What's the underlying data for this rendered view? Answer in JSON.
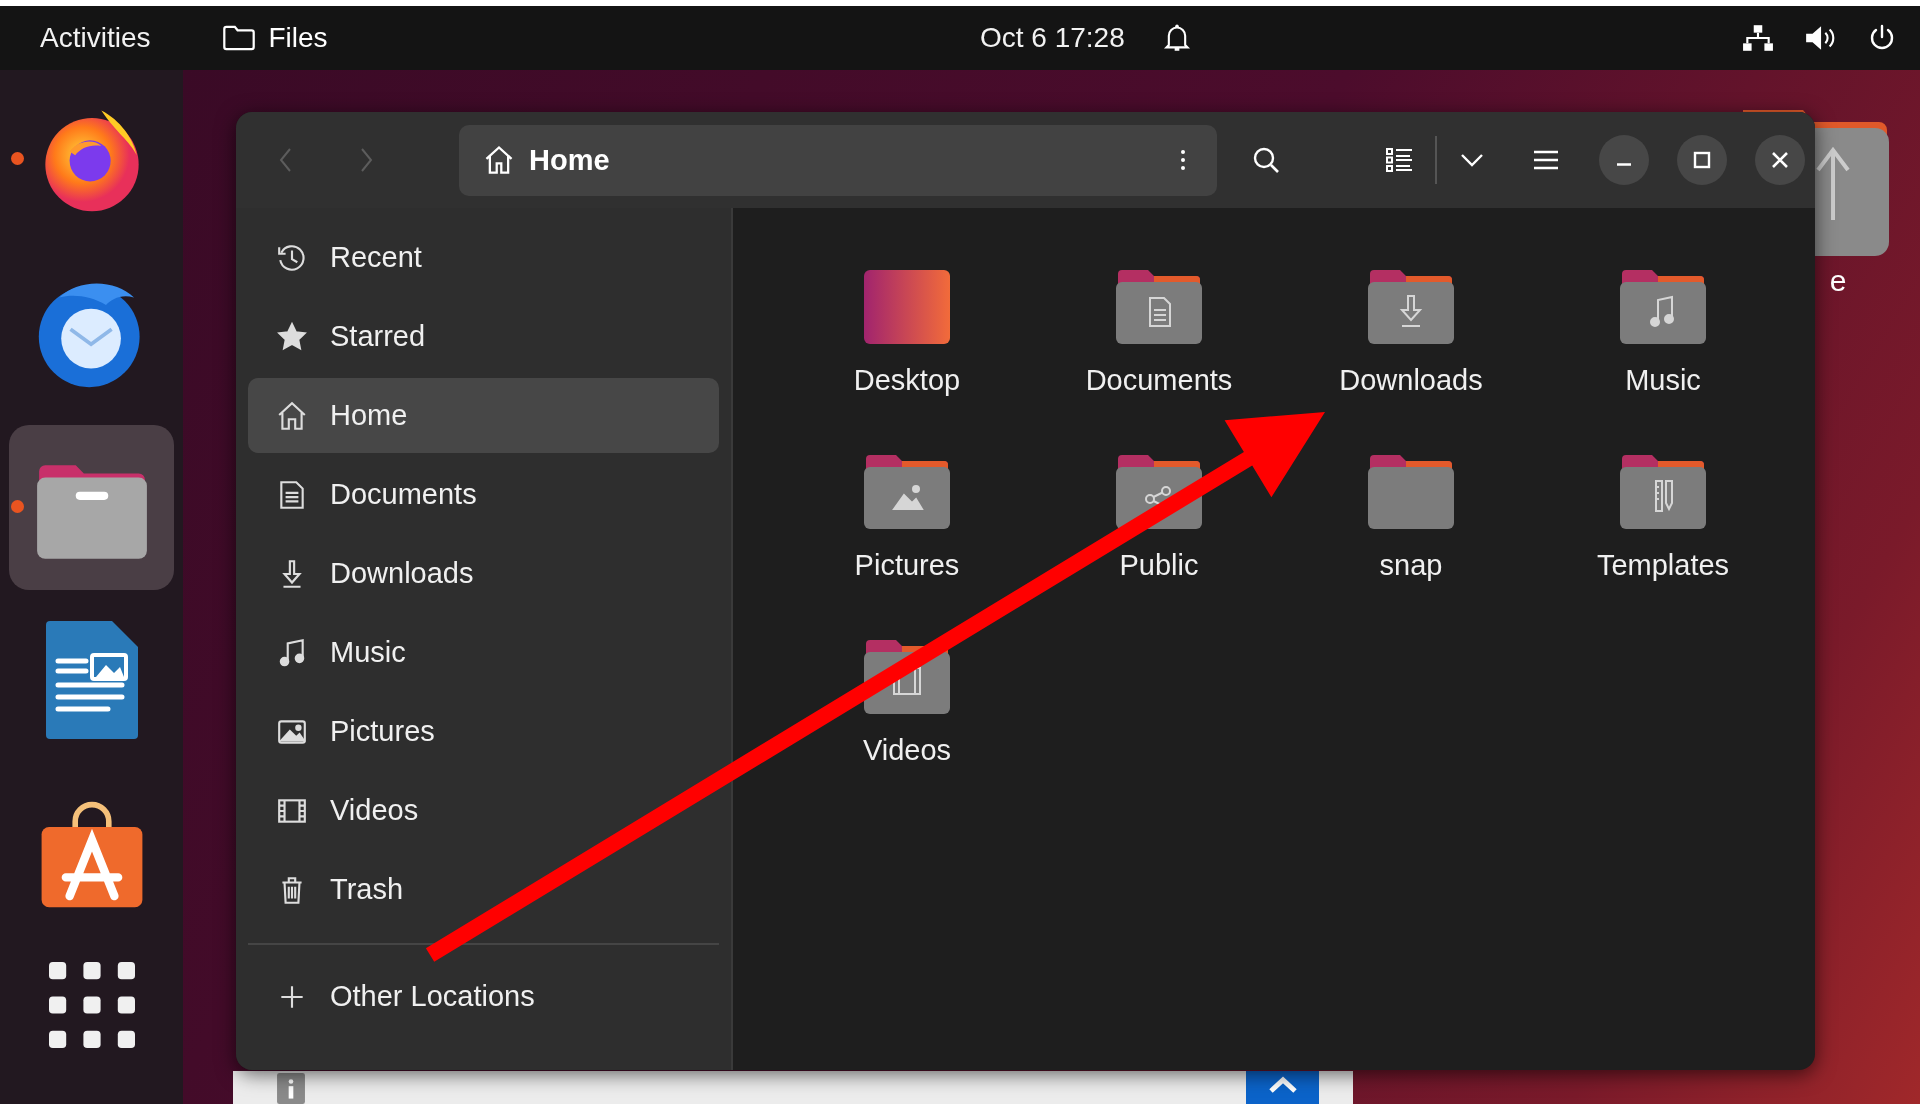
{
  "top_bar": {
    "activities": "Activities",
    "app_menu": "Files",
    "clock": "Oct 6  17:28"
  },
  "dock": [
    {
      "kind": "browser",
      "running": true,
      "selected": false
    },
    {
      "kind": "mail",
      "running": false,
      "selected": false
    },
    {
      "kind": "files",
      "running": true,
      "selected": true
    },
    {
      "kind": "writer",
      "running": false,
      "selected": false
    },
    {
      "kind": "store",
      "running": false,
      "selected": false
    }
  ],
  "desktop_icon": {
    "label": "e"
  },
  "window": {
    "back_disabled": true,
    "forward_disabled": true,
    "path": "Home"
  },
  "sidebar": [
    {
      "label": "Recent",
      "kind": "recent",
      "selected": false
    },
    {
      "label": "Starred",
      "kind": "starred",
      "selected": false
    },
    {
      "label": "Home",
      "kind": "home",
      "selected": true
    },
    {
      "label": "Documents",
      "kind": "documents",
      "selected": false
    },
    {
      "label": "Downloads",
      "kind": "downloads",
      "selected": false
    },
    {
      "label": "Music",
      "kind": "music",
      "selected": false
    },
    {
      "label": "Pictures",
      "kind": "pictures",
      "selected": false
    },
    {
      "label": "Videos",
      "kind": "videos",
      "selected": false
    },
    {
      "label": "Trash",
      "kind": "trash",
      "selected": false
    }
  ],
  "other_locations": "Other Locations",
  "files": [
    {
      "name": "Desktop",
      "kind": "desktop"
    },
    {
      "name": "Documents",
      "kind": "documents"
    },
    {
      "name": "Downloads",
      "kind": "downloads"
    },
    {
      "name": "Music",
      "kind": "music"
    },
    {
      "name": "Pictures",
      "kind": "pictures"
    },
    {
      "name": "Public",
      "kind": "public"
    },
    {
      "name": "snap",
      "kind": "plain"
    },
    {
      "name": "Templates",
      "kind": "templates"
    },
    {
      "name": "Videos",
      "kind": "videos"
    }
  ]
}
